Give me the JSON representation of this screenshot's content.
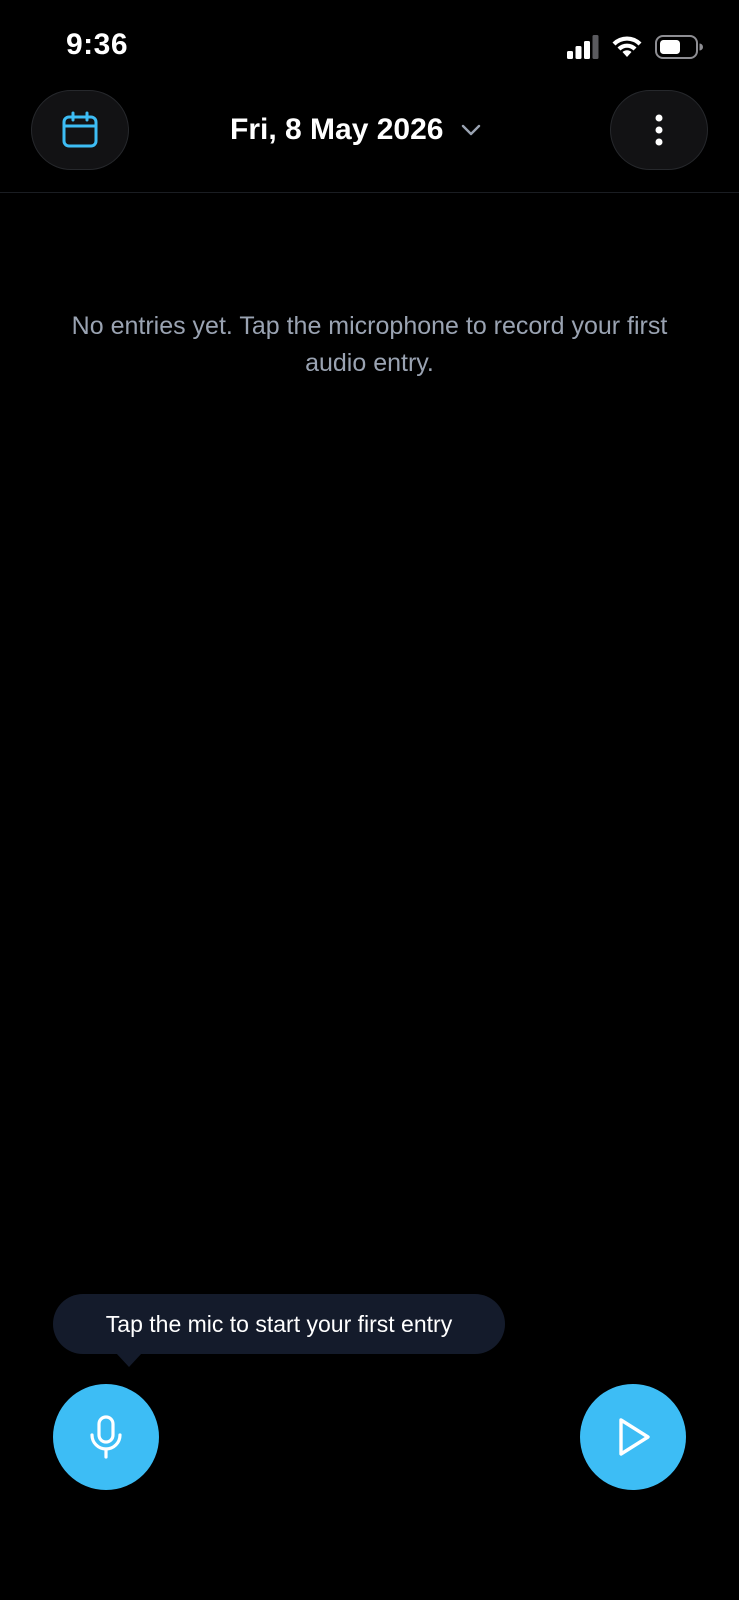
{
  "status_bar": {
    "time": "9:36",
    "icons": [
      "signal-icon",
      "wifi-icon",
      "battery-icon"
    ]
  },
  "header": {
    "date": "Fri, 8 May 2026",
    "icons": {
      "calendar": "calendar-icon",
      "dropdown": "chevron-down-icon",
      "menu": "more-vertical-icon"
    }
  },
  "main": {
    "empty_message": "No entries yet. Tap the microphone to record your first audio entry."
  },
  "tooltip": {
    "text": "Tap the mic to start your first entry"
  },
  "actions": {
    "record_icon": "microphone-icon",
    "play_icon": "play-icon"
  },
  "colors": {
    "background": "#000000",
    "accent": "#3dbdf5",
    "muted_text": "#9aa3b2",
    "tooltip_bg": "#141b2b",
    "button_bg": "#121214"
  }
}
